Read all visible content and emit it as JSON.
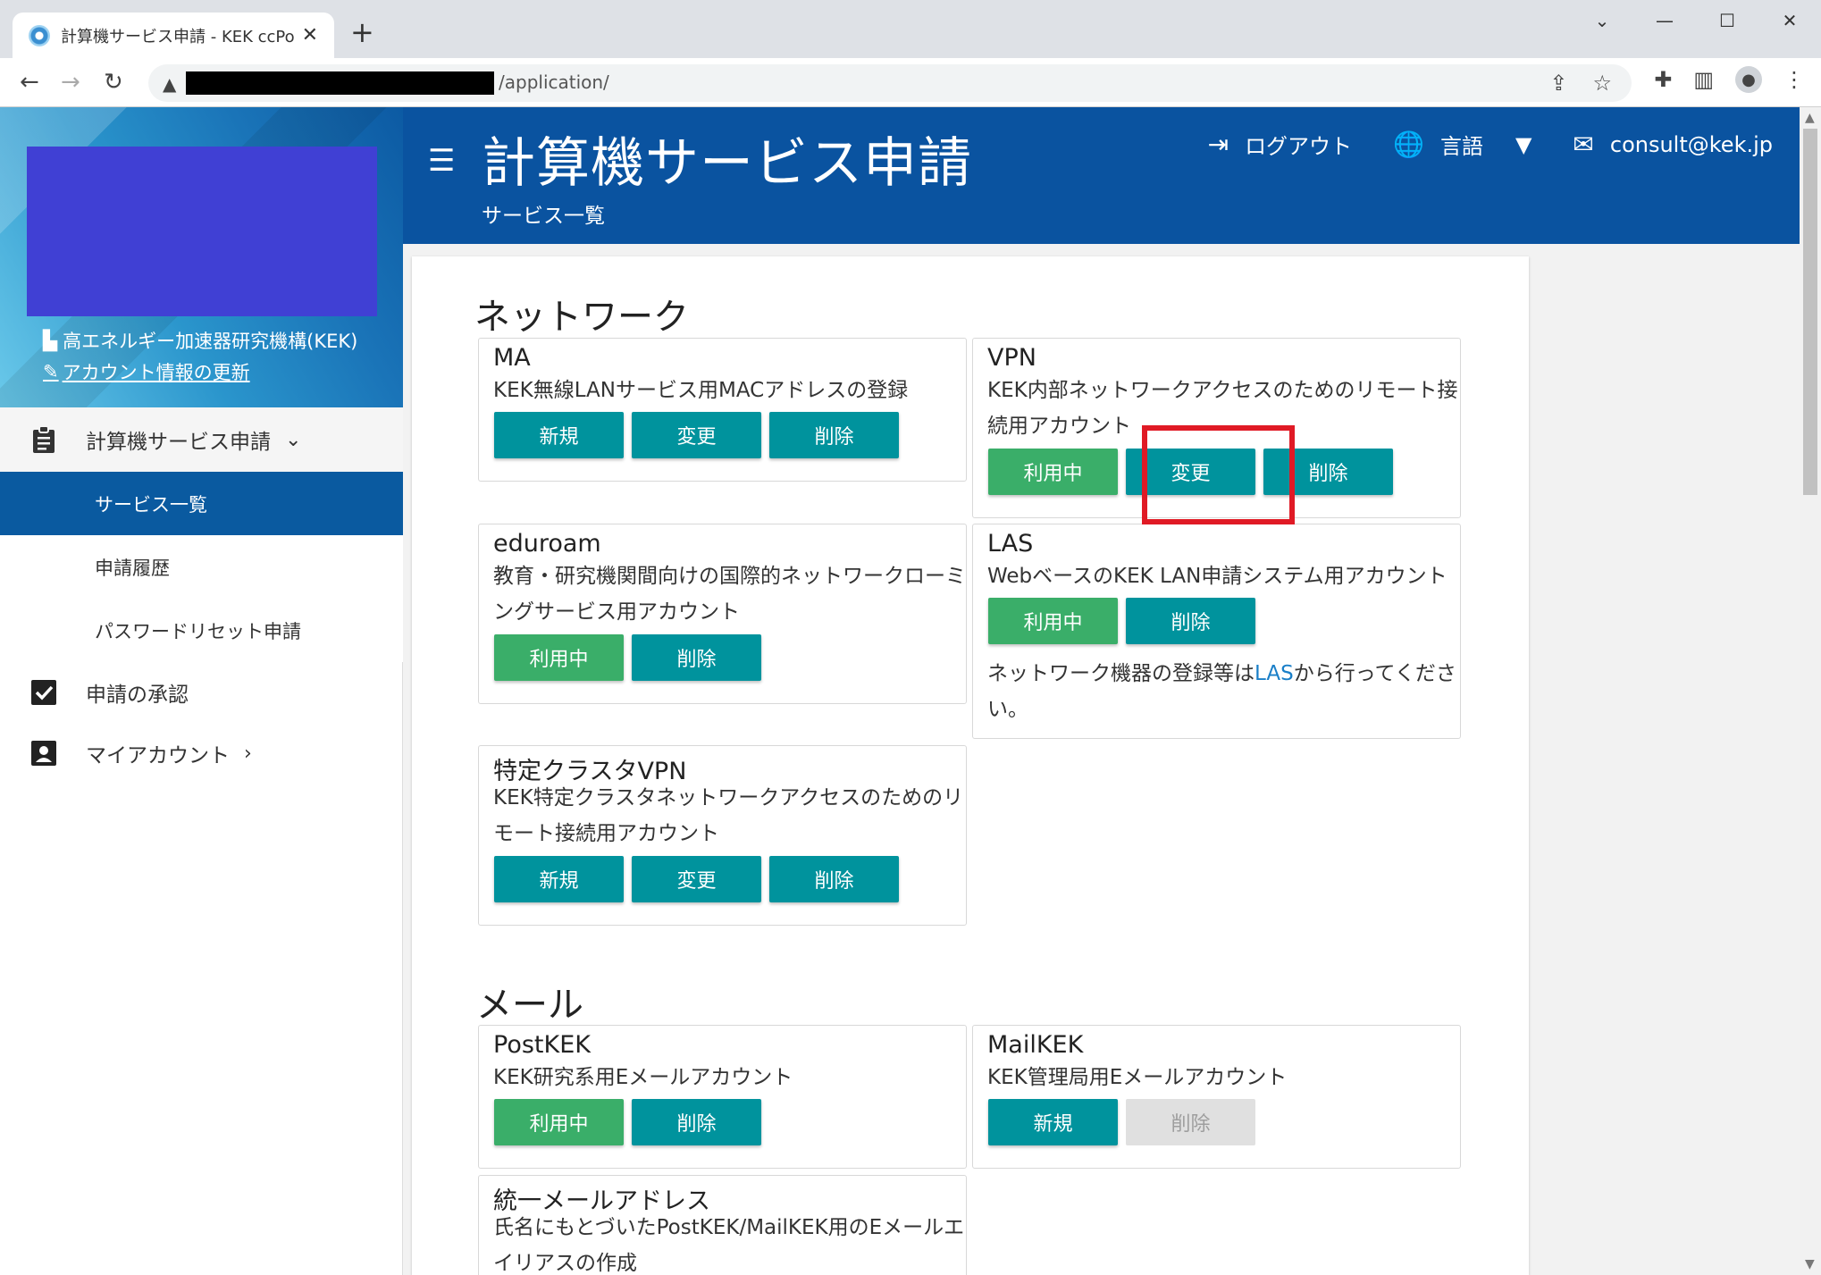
{
  "browser": {
    "tab_title": "計算機サービス申請 - KEK ccPortal",
    "url_path": "/application/"
  },
  "sidebar": {
    "org": "高エネルギー加速器研究機構(KEK)",
    "account_update": "アカウント情報の更新",
    "menu": {
      "apply_group": "計算機サービス申請",
      "sub_services": "サービス一覧",
      "sub_history": "申請履歴",
      "sub_password": "パスワードリセット申請",
      "approval": "申請の承認",
      "my_account": "マイアカウント"
    }
  },
  "header": {
    "title": "計算機サービス申請",
    "subtitle": "サービス一覧",
    "logout": "ログアウト",
    "language": "言語",
    "email": "consult@kek.jp"
  },
  "sections": {
    "network": "ネットワーク",
    "mail": "メール"
  },
  "services": {
    "ma": {
      "name": "MA",
      "desc": "KEK無線LANサービス用MACアドレスの登録",
      "btn_new": "新規",
      "btn_change": "変更",
      "btn_delete": "削除"
    },
    "vpn": {
      "name": "VPN",
      "desc": "KEK内部ネットワークアクセスのためのリモート接続用アカウント",
      "btn_inuse": "利用中",
      "btn_change": "変更",
      "btn_delete": "削除"
    },
    "eduroam": {
      "name": "eduroam",
      "desc": "教育・研究機関間向けの国際的ネットワークローミングサービス用アカウント",
      "btn_inuse": "利用中",
      "btn_delete": "削除"
    },
    "las": {
      "name": "LAS",
      "desc": "WebベースのKEK LAN申請システム用アカウント",
      "btn_inuse": "利用中",
      "btn_delete": "削除",
      "note_before": "ネットワーク機器の登録等は",
      "note_link": "LAS",
      "note_after": "から行ってください。"
    },
    "cluster_vpn": {
      "name": "特定クラスタVPN",
      "desc": "KEK特定クラスタネットワークアクセスのためのリモート接続用アカウント",
      "btn_new": "新規",
      "btn_change": "変更",
      "btn_delete": "削除"
    },
    "postkek": {
      "name": "PostKEK",
      "desc": "KEK研究系用Eメールアカウント",
      "btn_inuse": "利用中",
      "btn_delete": "削除"
    },
    "mailkek": {
      "name": "MailKEK",
      "desc": "KEK管理局用Eメールアカウント",
      "btn_new": "新規",
      "btn_delete": "削除"
    },
    "unified_mail": {
      "name": "統一メールアドレス",
      "desc": "氏名にもとづいたPostKEK/MailKEK用のEメールエイリアスの作成"
    }
  },
  "colors": {
    "header_blue": "#0a53a0",
    "teal_button": "#00939d",
    "green_button": "#3aae69",
    "highlight_red": "#e01a25"
  }
}
